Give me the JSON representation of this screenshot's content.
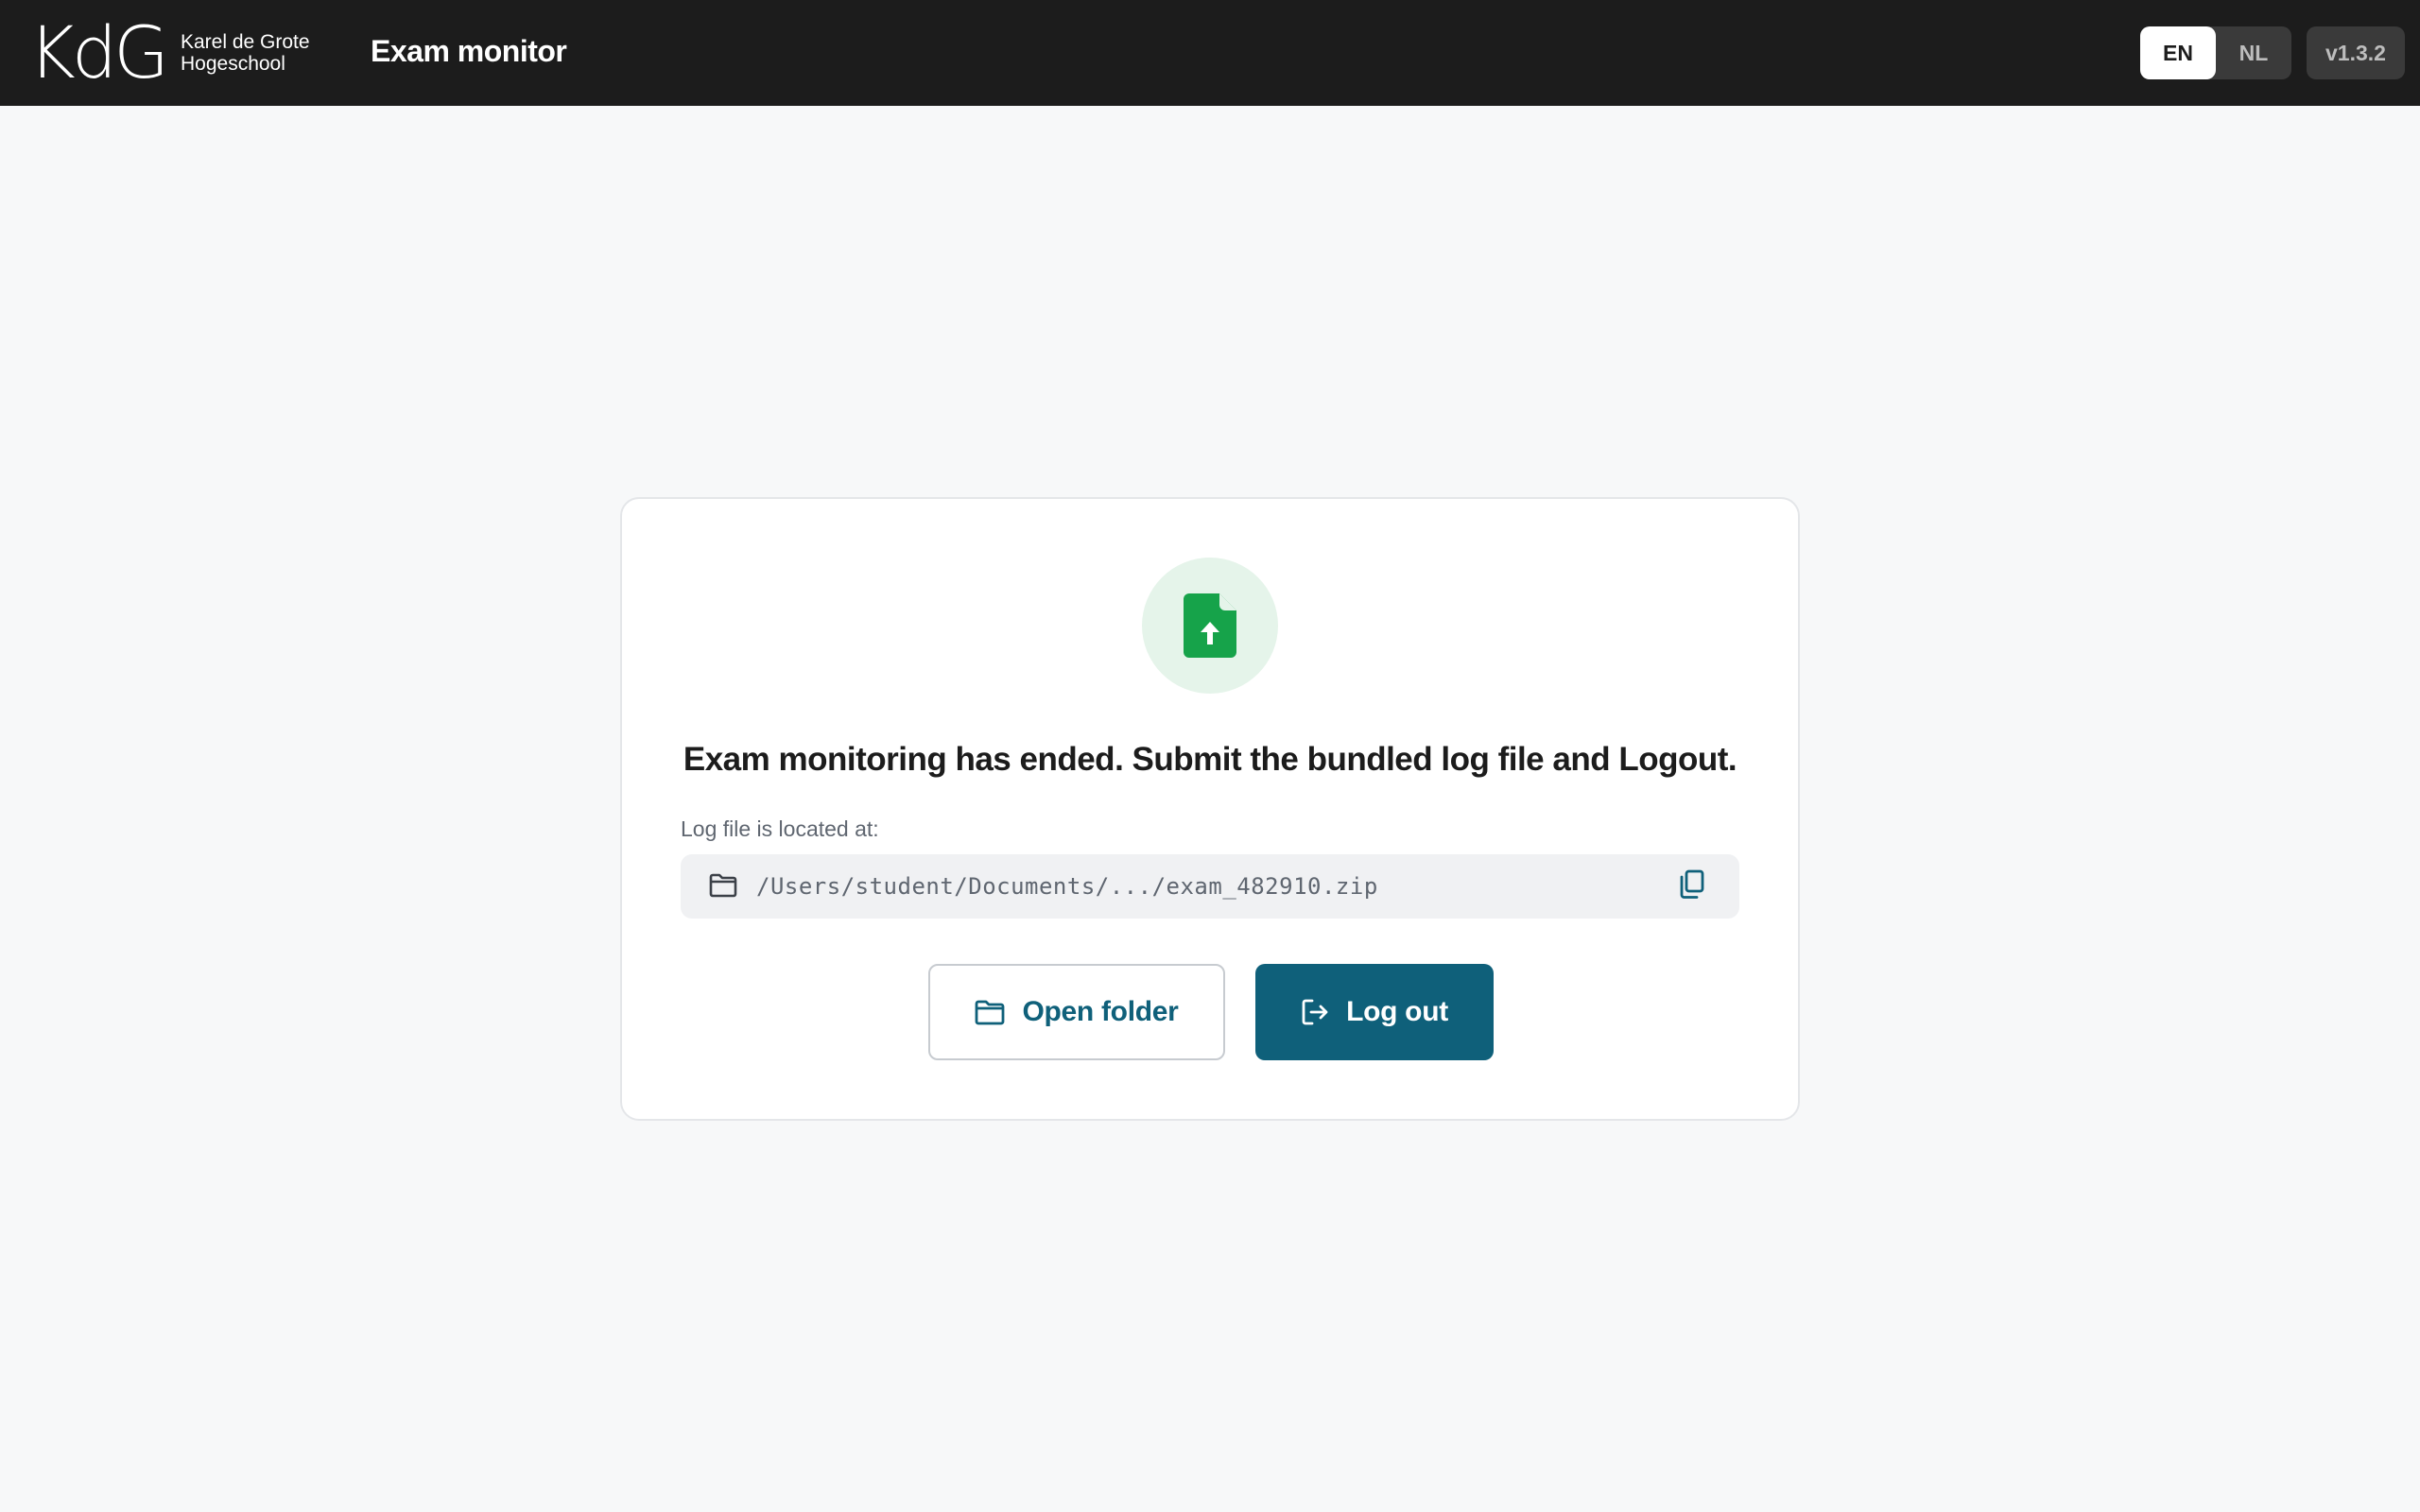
{
  "header": {
    "logo_mark": "KdG",
    "logo_line1": "Karel de Grote",
    "logo_line2": "Hogeschool",
    "app_title": "Exam monitor",
    "languages": [
      "EN",
      "NL"
    ],
    "active_language": "EN",
    "version": "v1.3.2"
  },
  "card": {
    "icon": "file-upload-icon",
    "headline": "Exam monitoring has ended. Submit the bundled log file and Logout.",
    "path_label": "Log file is located at:",
    "log_path": "/Users/student/Documents/.../exam_482910.zip",
    "open_folder_label": "Open folder",
    "logout_label": "Log out"
  },
  "colors": {
    "topbar": "#1c1c1c",
    "accent": "#0f607a",
    "success": "#16a34a",
    "success_bg": "#e5f4ea"
  }
}
